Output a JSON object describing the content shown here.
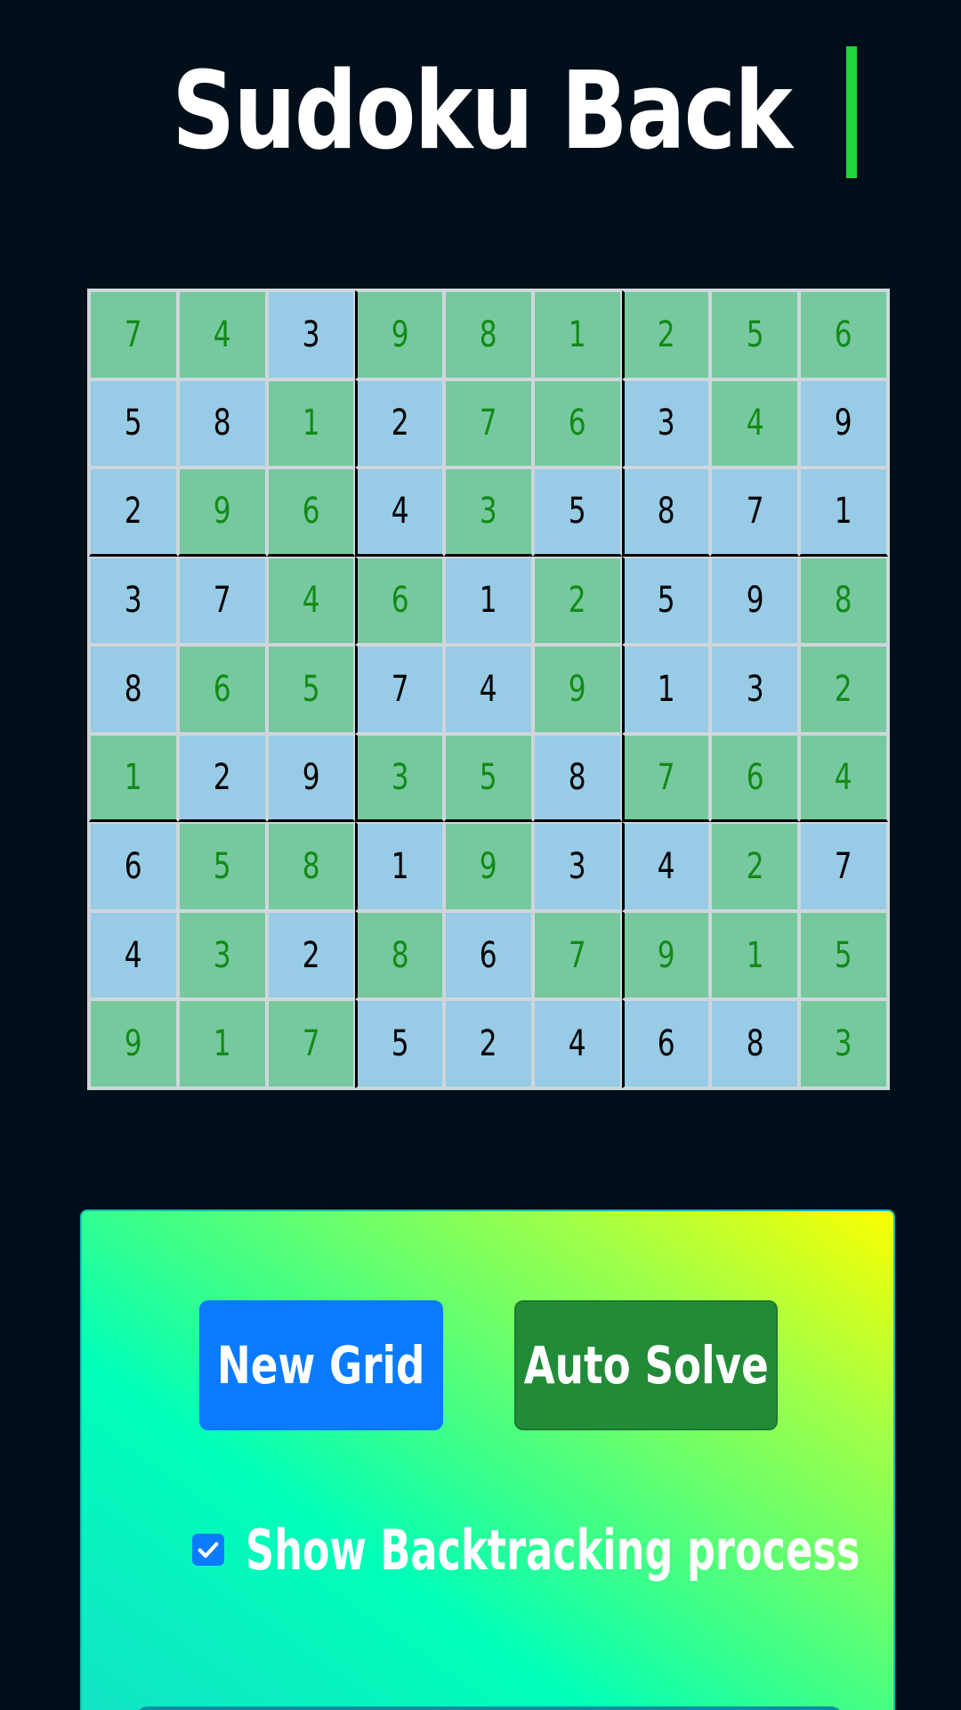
{
  "header": {
    "title": "Sudoku Back"
  },
  "board": {
    "rows": [
      [
        7,
        4,
        3,
        9,
        8,
        1,
        2,
        5,
        6
      ],
      [
        5,
        8,
        1,
        2,
        7,
        6,
        3,
        4,
        9
      ],
      [
        2,
        9,
        6,
        4,
        3,
        5,
        8,
        7,
        1
      ],
      [
        3,
        7,
        4,
        6,
        1,
        2,
        5,
        9,
        8
      ],
      [
        8,
        6,
        5,
        7,
        4,
        9,
        1,
        3,
        2
      ],
      [
        1,
        2,
        9,
        3,
        5,
        8,
        7,
        6,
        4
      ],
      [
        6,
        5,
        8,
        1,
        9,
        3,
        4,
        2,
        7
      ],
      [
        4,
        3,
        2,
        8,
        6,
        7,
        9,
        1,
        5
      ],
      [
        9,
        1,
        7,
        5,
        2,
        4,
        6,
        8,
        3
      ]
    ],
    "cell_states": [
      [
        "g",
        "g",
        "b",
        "g",
        "g",
        "g",
        "g",
        "g",
        "g"
      ],
      [
        "b",
        "b",
        "g",
        "b",
        "g",
        "g",
        "b",
        "g",
        "b"
      ],
      [
        "b",
        "g",
        "g",
        "b",
        "g",
        "b",
        "b",
        "b",
        "b"
      ],
      [
        "b",
        "b",
        "g",
        "g",
        "b",
        "g",
        "b",
        "b",
        "g"
      ],
      [
        "b",
        "g",
        "g",
        "b",
        "b",
        "g",
        "b",
        "b",
        "g"
      ],
      [
        "g",
        "b",
        "b",
        "g",
        "g",
        "b",
        "g",
        "g",
        "g"
      ],
      [
        "b",
        "g",
        "g",
        "b",
        "g",
        "b",
        "b",
        "g",
        "b"
      ],
      [
        "b",
        "g",
        "b",
        "g",
        "b",
        "g",
        "g",
        "g",
        "g"
      ],
      [
        "g",
        "g",
        "g",
        "b",
        "b",
        "b",
        "b",
        "b",
        "g"
      ]
    ],
    "colors": {
      "solved_cell_bg": "#76c99e",
      "solved_digit": "#138a18",
      "given_cell_bg": "#97cbe6",
      "given_digit": "#000000"
    }
  },
  "controls": {
    "new_grid_label": "New Grid",
    "auto_solve_label": "Auto Solve",
    "show_backtracking_label": "Show Backtracking process",
    "show_backtracking_checked": true,
    "colors": {
      "new_grid_bg": "#0a7bff",
      "auto_solve_bg": "#228b38",
      "caret": "#21d63a"
    }
  }
}
